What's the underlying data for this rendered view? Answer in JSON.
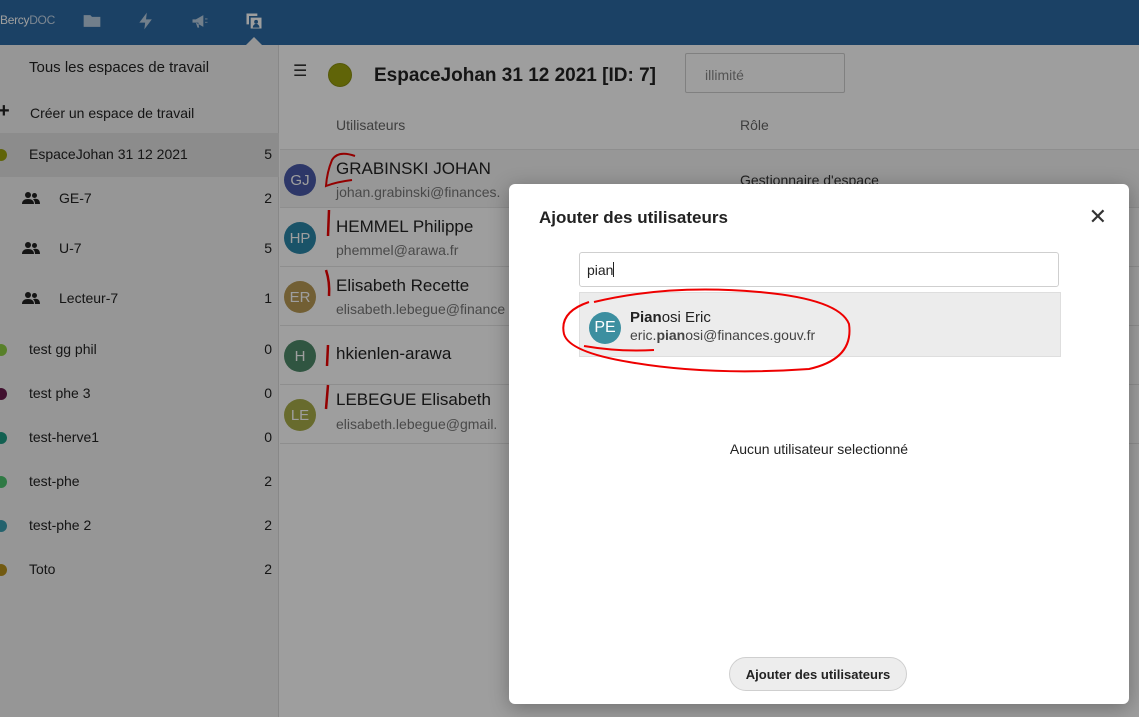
{
  "app": {
    "brand_part1": "Bercy",
    "brand_part2": "DOC"
  },
  "topbar": {
    "icons": [
      "folder-icon",
      "bolt-icon",
      "megaphone-icon",
      "workspace-users-icon"
    ],
    "active_icon": "workspace-users-icon"
  },
  "sidebar": {
    "all_workspaces": "Tous les espaces de travail",
    "create_label": "Créer un espace de travail",
    "create_icon": "plus-icon",
    "workspaces": [
      {
        "label": "EspaceJohan 31 12 2021",
        "count": "5",
        "color": "#9ca20e",
        "active": true
      },
      {
        "label": "test gg phil",
        "count": "0",
        "color": "#8fcf43"
      },
      {
        "label": "test phe 3",
        "count": "0",
        "color": "#6a1b4d"
      },
      {
        "label": "test-herve1",
        "count": "0",
        "color": "#1e9c84"
      },
      {
        "label": "test-phe",
        "count": "2",
        "color": "#4cc46e"
      },
      {
        "label": "test-phe 2",
        "count": "2",
        "color": "#3b9fb0"
      },
      {
        "label": "Toto",
        "count": "2",
        "color": "#b8911c"
      }
    ],
    "groups": [
      {
        "label": "GE-7",
        "count": "2",
        "icon": "group-icon"
      },
      {
        "label": "U-7",
        "count": "5",
        "icon": "group-icon"
      },
      {
        "label": "Lecteur-7",
        "count": "1",
        "icon": "group-icon"
      }
    ]
  },
  "main": {
    "menu_icon": "hamburger-icon",
    "workspace_title": "EspaceJohan 31 12 2021 [ID: 7]",
    "workspace_color": "#9ca20e",
    "quota_placeholder": "illimité",
    "columns": {
      "users": "Utilisateurs",
      "role": "Rôle"
    },
    "users": [
      {
        "initials": "GJ",
        "name": "GRABINSKI JOHAN",
        "email": "johan.grabinski@finances.",
        "role": "Gestionnaire d'espace",
        "color": "#4a5aa8"
      },
      {
        "initials": "HP",
        "name": "HEMMEL Philippe",
        "email": "phemmel@arawa.fr",
        "role": "",
        "color": "#2b86a8"
      },
      {
        "initials": "ER",
        "name": "Elisabeth Recette",
        "email": "elisabeth.lebegue@finance",
        "role": "",
        "color": "#b99a55"
      },
      {
        "initials": "H",
        "name": "hkienlen-arawa",
        "email": "",
        "role": "",
        "color": "#4e8a6a"
      },
      {
        "initials": "LE",
        "name": "LEBEGUE Elisabeth",
        "email": "elisabeth.lebegue@gmail.",
        "role": "",
        "color": "#a8ad4a"
      }
    ]
  },
  "modal": {
    "title": "Ajouter des utilisateurs",
    "close_icon": "close-icon",
    "search_value": "pian",
    "suggestion": {
      "initials": "PE",
      "name_match": "Pian",
      "name_rest": "osi Eric",
      "email_pre": "eric.",
      "email_match": "pian",
      "email_rest": "osi@finances.gouv.fr"
    },
    "empty_message": "Aucun utilisateur selectionné",
    "add_button": "Ajouter des utilisateurs"
  }
}
